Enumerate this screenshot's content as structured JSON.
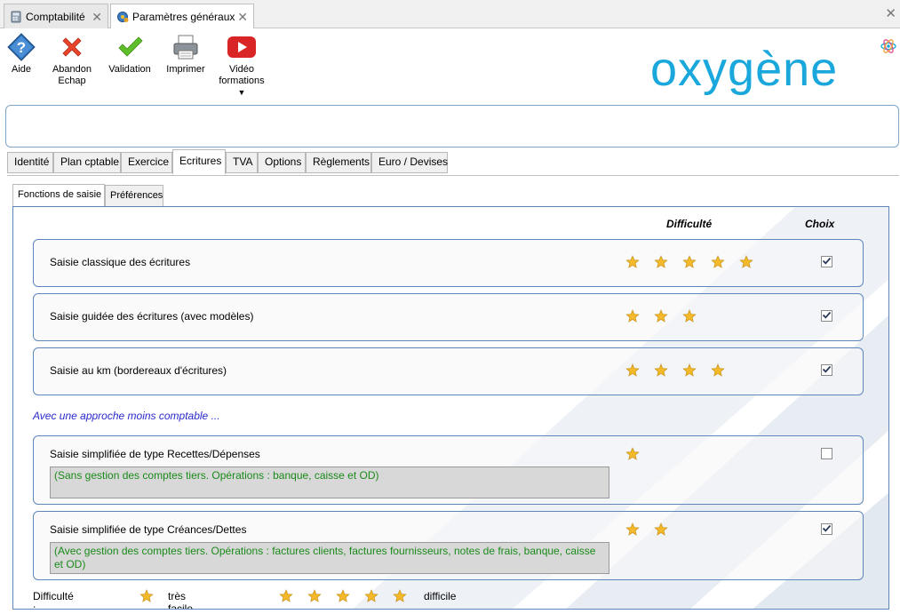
{
  "doc_tabs": [
    {
      "label": "Comptabilité",
      "close": "✕"
    },
    {
      "label": "Paramètres généraux",
      "close": "✕"
    }
  ],
  "window_close": "✕",
  "toolbar": {
    "help": "Aide",
    "cancel": "Abandon\nEchap",
    "validate": "Validation",
    "print": "Imprimer",
    "video": "Vidéo\nformations"
  },
  "logo": "oxygène",
  "main_tabs": [
    "Identité",
    "Plan cptable",
    "Exercice",
    "Ecritures",
    "TVA",
    "Options",
    "Règlements",
    "Euro / Devises"
  ],
  "active_main_tab": "Ecritures",
  "sub_tabs": [
    "Fonctions de saisie",
    "Préférences"
  ],
  "active_sub_tab": "Fonctions de saisie",
  "columns": {
    "difficulty": "Difficulté",
    "choice": "Choix"
  },
  "options": [
    {
      "label": "Saisie classique des écritures",
      "stars": 5,
      "checked": true,
      "description": ""
    },
    {
      "label": "Saisie guidée des écritures (avec modèles)",
      "stars": 3,
      "checked": true,
      "description": ""
    },
    {
      "label": "Saisie au km (bordereaux d'écritures)",
      "stars": 4,
      "checked": true,
      "description": ""
    }
  ],
  "approach_note": "Avec une approche moins comptable ...",
  "simple_options": [
    {
      "label": "Saisie simplifiée de type Recettes/Dépenses",
      "stars": 1,
      "checked": false,
      "description": "(Sans gestion des comptes tiers. Opérations : banque, caisse et OD)"
    },
    {
      "label": "Saisie simplifiée de type Créances/Dettes",
      "stars": 2,
      "checked": true,
      "description": "(Avec gestion des comptes tiers. Opérations : factures clients, factures fournisseurs, notes de frais, banque, caisse et OD)"
    }
  ],
  "legend": {
    "title": "Difficulté :",
    "easy": "très facile",
    "hard": "difficile",
    "easy_stars": 1,
    "hard_stars": 5
  },
  "colors": {
    "accent": "#1aa7dc",
    "border": "#5d87b9",
    "star": "#f2b92a",
    "green_text": "#1a8a1a",
    "blue_text": "#2a2acc"
  }
}
